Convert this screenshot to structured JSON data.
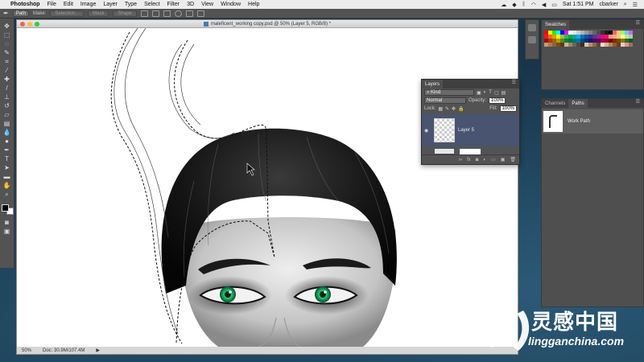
{
  "menubar": {
    "app_name": "Photoshop",
    "items": [
      "File",
      "Edit",
      "Image",
      "Layer",
      "Type",
      "Select",
      "Filter",
      "3D",
      "View",
      "Window",
      "Help"
    ],
    "clock": "Sat 1:51 PM",
    "user": "cbarker"
  },
  "options_bar": {
    "mode": "Path",
    "make_label": "Make:",
    "selection_button": "Selection...",
    "mask_button": "Mask",
    "shape_button": "Shape"
  },
  "document": {
    "title": "maleficent_working copy.psd @ 50% (Layer 5, RGB/8) *",
    "zoom": "50%",
    "doc_info": "Doc: 30.9M/107.4M"
  },
  "swatches_panel": {
    "tab": "Swatches",
    "colors": [
      "#ff0000",
      "#ffff00",
      "#00ff00",
      "#00ffff",
      "#0000ff",
      "#ff00ff",
      "#ffffff",
      "#e6e6e6",
      "#cccccc",
      "#b3b3b3",
      "#999999",
      "#808080",
      "#666666",
      "#4d4d4d",
      "#333333",
      "#1a1a1a",
      "#000000",
      "#ff6666",
      "#ffcc66",
      "#99ff66",
      "#66ccff",
      "#cc66ff",
      "#ed1c24",
      "#f26522",
      "#f7941d",
      "#fff200",
      "#8dc63f",
      "#39b54a",
      "#00a651",
      "#00a99d",
      "#00aeef",
      "#0072bc",
      "#0054a6",
      "#2e3192",
      "#662d91",
      "#92278f",
      "#ec008c",
      "#ed145b",
      "#f5989d",
      "#f9ad81",
      "#fdc68a",
      "#fff799",
      "#c4df9b",
      "#a3d39c",
      "#9e0b0f",
      "#a0410d",
      "#a36209",
      "#aba000",
      "#598527",
      "#197b30",
      "#007236",
      "#00746b",
      "#0076a3",
      "#004a80",
      "#003471",
      "#1b1464",
      "#440e62",
      "#630460",
      "#9e005d",
      "#9e0039",
      "#790000",
      "#7b2e00",
      "#7d4900",
      "#827b00",
      "#406618",
      "#005e20",
      "#c69c6d",
      "#a67c52",
      "#8c6239",
      "#754c24",
      "#603913",
      "#c7b299",
      "#998675",
      "#736357",
      "#534741",
      "#362f2d",
      "#e1c8a0",
      "#b5906a",
      "#8a6a4a",
      "#5e4630",
      "#f5e1c3",
      "#d9b38c",
      "#b38659",
      "#8c5e30",
      "#664014",
      "#f0c8c8",
      "#d49898",
      "#a86868"
    ]
  },
  "paths_panel": {
    "tabs": [
      "Channels",
      "Paths"
    ],
    "active_tab": "Paths",
    "items": [
      {
        "name": "Work Path"
      }
    ]
  },
  "layers_panel": {
    "tab": "Layers",
    "filter": "Kind",
    "blend_mode": "Normal",
    "opacity_label": "Opacity:",
    "opacity_value": "100%",
    "lock_label": "Lock:",
    "fill_label": "Fill:",
    "fill_value": "100%",
    "layers": [
      {
        "name": "Layer 5"
      }
    ]
  },
  "watermark": {
    "main": "灵感中国",
    "sub": "lingganchina.com"
  }
}
